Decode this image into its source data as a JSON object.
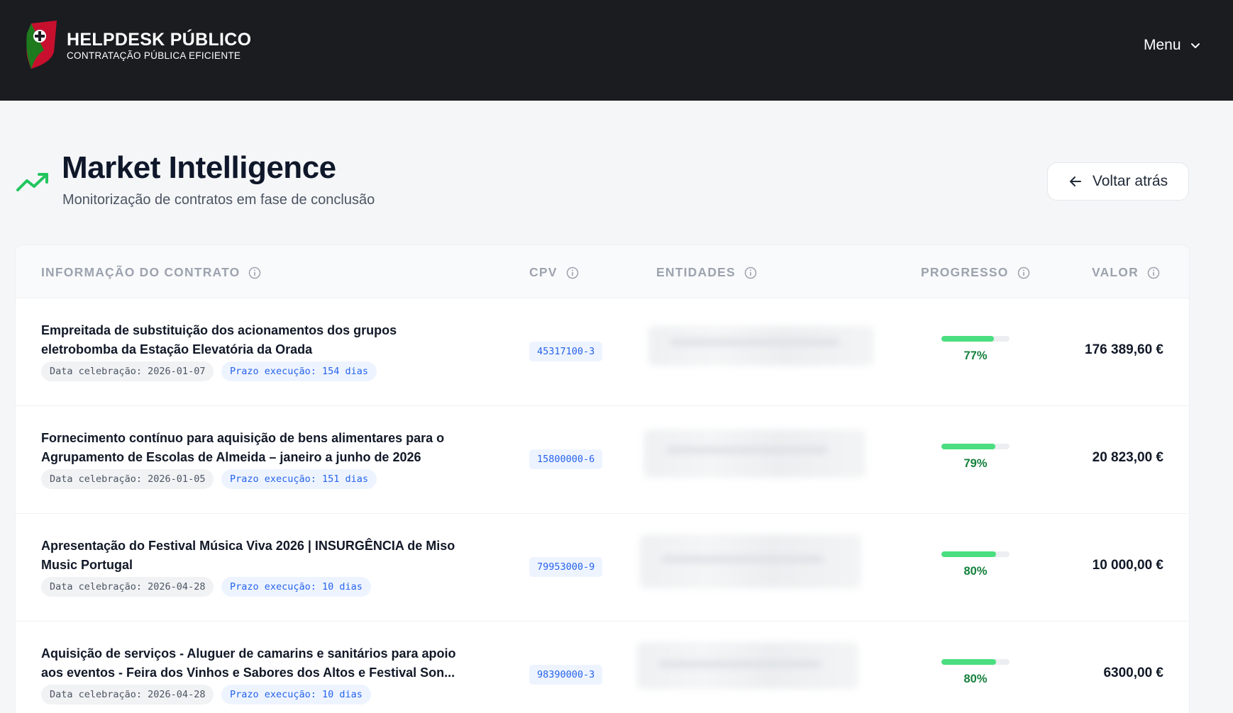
{
  "header": {
    "brand_title": "HELPDESK PÚBLICO",
    "brand_subtitle": "CONTRATAÇÃO PÚBLICA EFICIENTE",
    "menu_label": "Menu"
  },
  "page": {
    "title": "Market Intelligence",
    "subtitle": "Monitorização de contratos em fase de conclusão",
    "back_label": "Voltar atrás"
  },
  "table": {
    "columns": {
      "info": "INFORMAÇÃO DO CONTRATO",
      "cpv": "CPV",
      "entidades": "ENTIDADES",
      "progresso": "PROGRESSO",
      "valor": "VALOR"
    },
    "rows": [
      {
        "title": "Empreitada de substituição dos acionamentos dos grupos\neletrobomba da Estação Elevatória da Orada",
        "data_celebracao": "Data celebração: 2026-01-07",
        "prazo": "Prazo execução: 154 dias",
        "cpv": "45317100-3",
        "progress": 0.77,
        "progress_label": "77%",
        "valor": "176 389,60 €"
      },
      {
        "title": "Fornecimento contínuo para aquisição de bens alimentares para o\nAgrupamento de Escolas de Almeida – janeiro a junho de 2026",
        "data_celebracao": "Data celebração: 2026-01-05",
        "prazo": "Prazo execução: 151 dias",
        "cpv": "15800000-6",
        "progress": 0.79,
        "progress_label": "79%",
        "valor": "20 823,00 €"
      },
      {
        "title": "Apresentação do Festival Música Viva 2026 | INSURGÊNCIA de Miso\nMusic Portugal",
        "data_celebracao": "Data celebração: 2026-04-28",
        "prazo": "Prazo execução: 10 dias",
        "cpv": "79953000-9",
        "progress": 0.8,
        "progress_label": "80%",
        "valor": "10 000,00 €"
      },
      {
        "title": "Aquisição de serviços - Aluguer de camarins e sanitários para apoio\naos eventos - Feira dos Vinhos e Sabores dos Altos e Festival Son...",
        "data_celebracao": "Data celebração: 2026-04-28",
        "prazo": "Prazo execução: 10 dias",
        "cpv": "98390000-3",
        "progress": 0.8,
        "progress_label": "80%",
        "valor": "6300,00 €"
      }
    ]
  },
  "colors": {
    "header_bg": "#1b1c20",
    "accent_green": "#22c55e",
    "progress_fill": "#4ade80",
    "cpv_blue": "#2563eb"
  }
}
